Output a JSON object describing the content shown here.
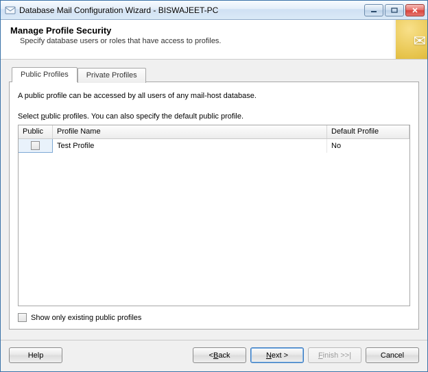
{
  "window": {
    "title": "Database Mail Configuration Wizard - BISWAJEET-PC"
  },
  "header": {
    "title": "Manage Profile Security",
    "subtitle": "Specify database users or roles that have access to profiles."
  },
  "tabs": [
    {
      "label": "Public Profiles",
      "active": true
    },
    {
      "label": "Private Profiles",
      "active": false
    }
  ],
  "tab_public": {
    "description1": "A public profile can be accessed by all users of any mail-host database.",
    "description2_pre": "Select ",
    "description2_underline": "p",
    "description2_post": "ublic profiles. You can also specify the default public profile.",
    "columns": {
      "public": "Public",
      "profile_name": "Profile Name",
      "default_profile": "Default Profile"
    },
    "rows": [
      {
        "checked": false,
        "profile_name": "Test Profile",
        "default_profile": "No"
      }
    ],
    "show_only_label": "Show only existing public profiles",
    "show_only_checked": false
  },
  "footer": {
    "help": "Help",
    "back_pre": "< ",
    "back_u": "B",
    "back_post": "ack",
    "next_u": "N",
    "next_post": "ext >",
    "finish_u": "F",
    "finish_post": "inish >>|",
    "cancel": "Cancel"
  }
}
